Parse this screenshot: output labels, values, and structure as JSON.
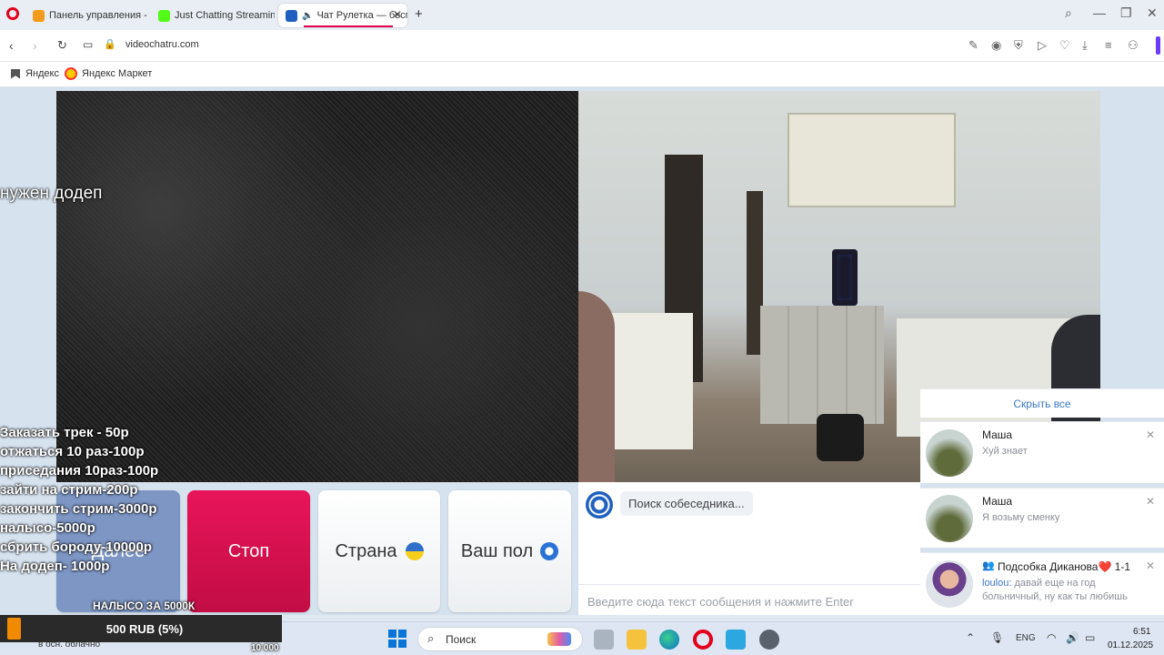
{
  "browser": {
    "tabs": [
      {
        "label": "Панель управления - Do",
        "icon": "donation-icon",
        "color": "#f29b1d"
      },
      {
        "label": "Just Chatting Streaming -",
        "icon": "kick-icon",
        "color": "#53fc18"
      },
      {
        "label": "Чат Рулетка — беспл",
        "icon": "chatroulette-icon",
        "color": "#1f5fbf",
        "active": true
      }
    ],
    "url": "videochatru.com",
    "bookmarks": [
      {
        "label": "Яндекс",
        "icon": "bookmark-icon"
      },
      {
        "label": "Яндекс Маркет",
        "icon": "yandex-market-icon"
      }
    ]
  },
  "stream_overlay": {
    "headline": "нужен додеп",
    "menu": [
      "Заказать трек - 50р",
      "отжаться 10 раз-100р",
      "приседания 10раз-100р",
      "зайти на стрим-200р",
      "закончить стрим-3000р",
      "налысо-5000р",
      "сбрить бороду-10000р",
      "На додеп- 1000р"
    ],
    "goal_label": "НАЛЫСО ЗА 5000К",
    "donation": "500 RUB (5%)",
    "goal_total": "10 000",
    "weather": "в осн. облачно"
  },
  "controls": {
    "next_label": "Далее",
    "stop_label": "Стоп",
    "country_label": "Страна",
    "gender_label": "Ваш пол",
    "status": "Поиск собеседника...",
    "chat_placeholder": "Введите сюда текст сообщения и нажмите Enter"
  },
  "notifications": {
    "hide_all": "Скрыть все",
    "items": [
      {
        "name": "Маша",
        "message": "Хуй знает"
      },
      {
        "name": "Маша",
        "message": "Я возьму сменку"
      },
      {
        "name": "Подсобка Диканова❤️ 1-1",
        "sender": "loulou:",
        "message": "давай еще на год больничный, ну как ты любишь"
      }
    ]
  },
  "taskbar": {
    "search_placeholder": "Поиск",
    "language": "ENG",
    "time": "6:51",
    "date": "01.12.2025"
  },
  "colors": {
    "stop": "#d8104a",
    "next": "#7d96c4",
    "accent": "#e0004d"
  }
}
